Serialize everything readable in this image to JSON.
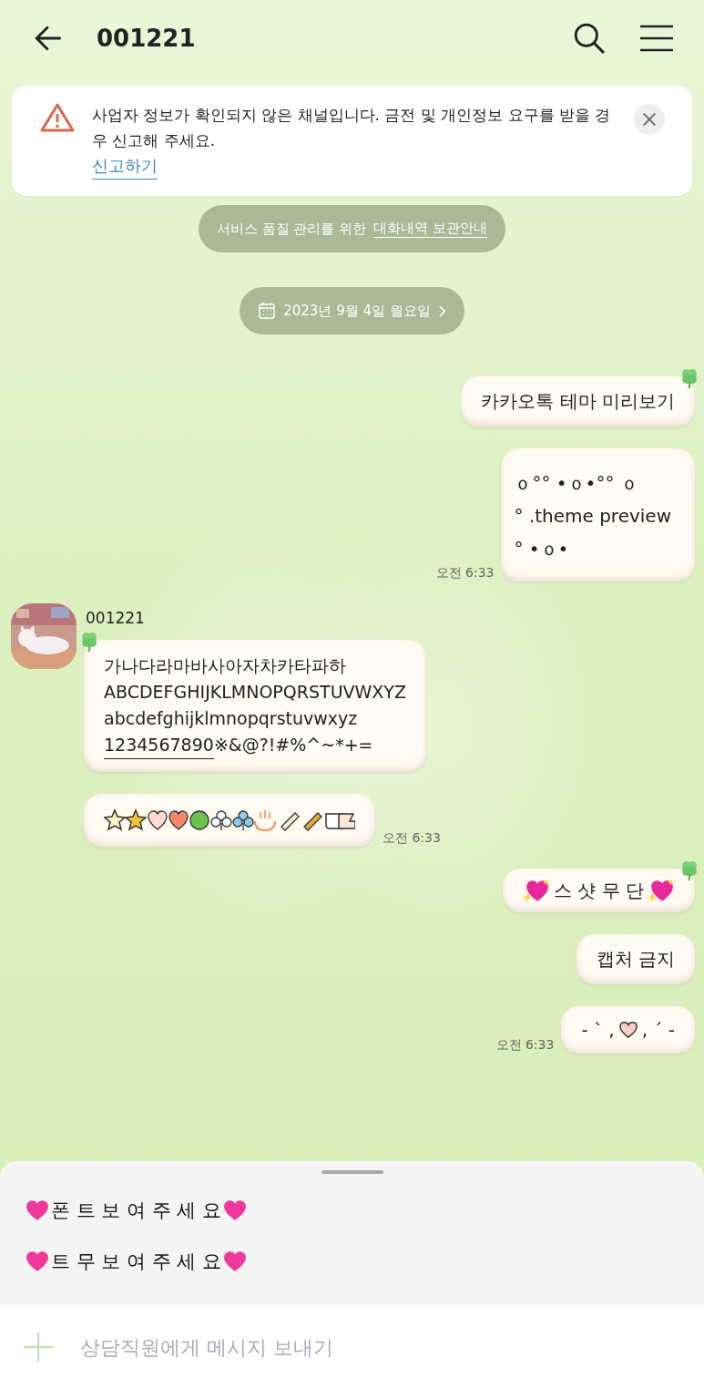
{
  "header": {
    "title": "001221"
  },
  "notice": {
    "text": "사업자 정보가 확인되지 않은 채널입니다. 금전 및 개인정보 요구를 받을 경우 신고해 주세요.",
    "link": "신고하기"
  },
  "system_notice": {
    "text": "서비스 품질 관리를 위한",
    "link": "대화내역 보관안내"
  },
  "date_divider": {
    "label": "2023년 9월 4일 월요일"
  },
  "messages": [
    {
      "kind": "sent_text",
      "clover": true,
      "text": "카카오톡 테마 미리보기"
    },
    {
      "kind": "sent_art",
      "clover": false,
      "lines": [
        "ｏ°° •ｏ•°° ｏ",
        "° .theme preview",
        "° •ｏ•"
      ],
      "time": "오전 6:33"
    },
    {
      "kind": "received_font",
      "clover": true,
      "sender": "001221",
      "lines": [
        "가나다라마바사아자차카타파하",
        "ABCDEFGHIJKLMNOPQRSTUVWXYZ",
        "abcdefghijklmnopqrstuvwxyz"
      ],
      "number": "1234567890",
      "symbols": " ※&@?!#%^~*+="
    },
    {
      "kind": "received_symbols",
      "clover": false,
      "time": "오전 6:33"
    },
    {
      "kind": "sent_hearts",
      "clover": true,
      "text": "스 샷 무 단"
    },
    {
      "kind": "sent_text",
      "clover": false,
      "text": "캡처 금지"
    },
    {
      "kind": "sent_kaomoji",
      "clover": false,
      "left": "- ˋ ,",
      "right": ", ˊ -",
      "time": "오전 6:33"
    }
  ],
  "quick_replies": [
    "폰 트 보 여 주 세 요",
    "트 무 보 여 주 세 요"
  ],
  "composer": {
    "placeholder": "상담직원에게 메시지 보내기"
  }
}
